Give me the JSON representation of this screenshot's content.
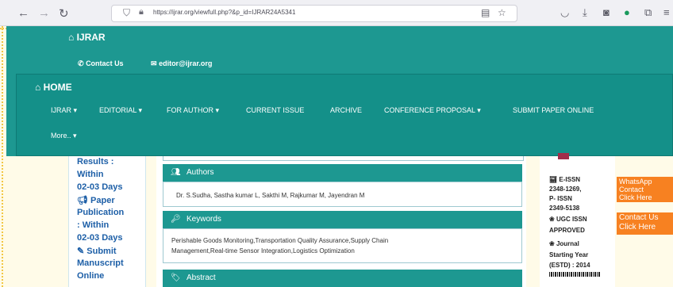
{
  "browser": {
    "url": "https://ijrar.org/viewfull.php?&p_id=IJRAR24A5341"
  },
  "header": {
    "brand": "IJRAR",
    "contact_label": "Contact Us",
    "email": "editor@ijrar.org"
  },
  "nav": {
    "home": "HOME",
    "items": [
      {
        "label": "IJRAR",
        "dropdown": true
      },
      {
        "label": "EDITORIAL",
        "dropdown": true
      },
      {
        "label": "FOR AUTHOR",
        "dropdown": true
      },
      {
        "label": "CURRENT ISSUE",
        "dropdown": false
      },
      {
        "label": "ARCHIVE",
        "dropdown": false
      },
      {
        "label": "CONFERENCE PROPOSAL",
        "dropdown": true
      },
      {
        "label": "SUBMIT PAPER ONLINE",
        "dropdown": false
      }
    ],
    "more": "More.."
  },
  "left_sidebar": {
    "lines": [
      "Results :",
      "Within",
      "02-03 Days"
    ],
    "paper_pub": [
      "Paper",
      "Publication",
      ": Within",
      "02-03 Days"
    ],
    "submit": [
      "Submit",
      "Manuscript",
      "Online"
    ]
  },
  "article": {
    "authors_title": "Authors",
    "authors": "Dr. S.Sudha,  Sastha kumar L,  Sakthi M,  Rajkumar M,  Jayendran M",
    "keywords_title": "Keywords",
    "keywords_line1": "Perishable Goods Monitoring,Transportation Quality Assurance,Supply Chain",
    "keywords_line2": "Management,Real-time Sensor Integration,Logistics Optimization",
    "abstract_title": "Abstract"
  },
  "right_sidebar": {
    "eissn": [
      "E-ISSN",
      "2348-1269,",
      "P- ISSN",
      "2349-5138"
    ],
    "ugc": [
      "UGC ISSN",
      "APPROVED"
    ],
    "journal": [
      "Journal",
      "Starting Year",
      "(ESTD) : 2014"
    ]
  },
  "whatsapp": [
    "WhatsApp",
    "Contact",
    "Click Here"
  ],
  "contact_us": [
    "Contact Us",
    "Click Here"
  ],
  "colors": {
    "teal": "#1d9891",
    "link_blue": "#1d5fa7",
    "orange": "#f78121"
  }
}
